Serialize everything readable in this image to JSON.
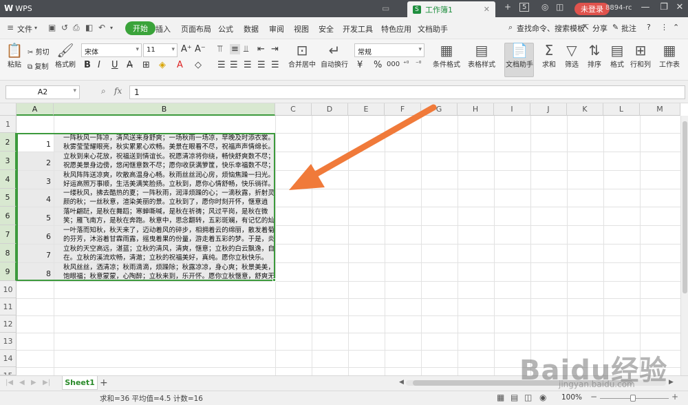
{
  "titlebar": {
    "app_name": "WPS",
    "tab_title": "工作簿1",
    "tab_count": "5",
    "login_button": "未登录",
    "user_id": "8894-rc"
  },
  "menubar": {
    "file": "文件",
    "tabs": [
      "开始",
      "插入",
      "页面布局",
      "公式",
      "数据",
      "审阅",
      "视图",
      "安全",
      "开发工具",
      "特色应用",
      "文档助手"
    ],
    "search": "查找命令、搜索模板",
    "share": "分享",
    "annotate": "批注"
  },
  "ribbon": {
    "paste": "粘贴",
    "cut": "剪切",
    "copy": "复制",
    "format_painter": "格式刷",
    "font_name": "宋体",
    "font_size": "11",
    "merge_center": "合并居中",
    "wrap_text": "自动换行",
    "number_format": "常规",
    "percent": "%",
    "thousands": "000",
    "cond_format": "条件格式",
    "table_style": "表格样式",
    "doc_assistant": "文档助手",
    "sum": "求和",
    "filter": "筛选",
    "sort": "排序",
    "format": "格式",
    "row_col": "行和列",
    "worksheet": "工作表"
  },
  "formula": {
    "cell_ref": "A2",
    "fx": "fx",
    "value": "1"
  },
  "columns": [
    "A",
    "B",
    "C",
    "D",
    "E",
    "F",
    "G",
    "H",
    "I",
    "J",
    "K",
    "L",
    "M"
  ],
  "rows": [
    "1",
    "2",
    "3",
    "4",
    "5",
    "6",
    "7",
    "8",
    "9",
    "10",
    "11",
    "12",
    "13",
    "14",
    "15"
  ],
  "cells": {
    "numbers": [
      "1",
      "2",
      "3",
      "4",
      "5",
      "6",
      "7",
      "8"
    ],
    "text_lines": [
      "一阵秋风一阵凉，清风送来身舒爽；一场秋雨一场凉，早晚及时添衣裳。",
      "秋雾莹莹耀眼亮，秋实累累心欢畅。美景在眼看不尽，祝福声声情绵长。",
      "立秋到来心花放，祝福送到情谊长。祝愿清凉将你绕，畅快舒爽数不尽；",
      "祝愿美景身边傍，悠闲惬意数不尽；愿你收获满箩筐，快乐幸福数不尽；",
      "秋风阵阵送凉爽，吹散高温身心畅。秋雨丝丝润心房，烦恼焦躁一扫光。",
      "好运高照万事顺，生活美满笑脸扬。立秋到，愿你心情舒畅，快乐徜徉。",
      "一缕秋风，拂去酷热的夏；一阵秋雨，润泽烦躁的心；一滴秋露，折射灵",
      "颜的秋；一丝秋意，渲染美丽的景。立秋到了，愿你时刻开怀，惬意逍",
      "落叶翩跹，是秋在舞蹈；寒蝉嘶喊，是秋在祈祷；风过平岗，是秋在微",
      "笑；雁飞南方，是秋在奔跑。秋意中，思念翻转，五彩斑斓，有记忆的灿",
      "一叶落而知秋，秋天来了，迈动着风的碎步，相拥着云的绵丽，散发着菊",
      "的芬芳，沐浴着甘霖雨露，摇曳着果的份量，游走着五彩的梦。于是，炎",
      "立秋的天空高远，湛蓝；立秋的清风，清爽，惬意；立秋的白云飘逸，自",
      "在。立秋的溪流欢畅，清澈；立秋的祝福美好，真纯。愿你立秋快乐。",
      "秋风丝丝，洒清凉；秋雨滴滴，烦躁除；秋露凉凉，身心爽；秋景美美，",
      "饱眼福；秋意蒙蒙，心陶醉；立秋来到，乐开怀。愿你立秋惬意，舒爽无"
    ]
  },
  "sheets": {
    "active": "Sheet1",
    "add": "+"
  },
  "status": {
    "summary": "求和=36  平均值=4.5  计数=16",
    "zoom": "100%"
  },
  "watermark": {
    "main": "Baidu经验",
    "sub": "jingyan.baidu.com"
  }
}
